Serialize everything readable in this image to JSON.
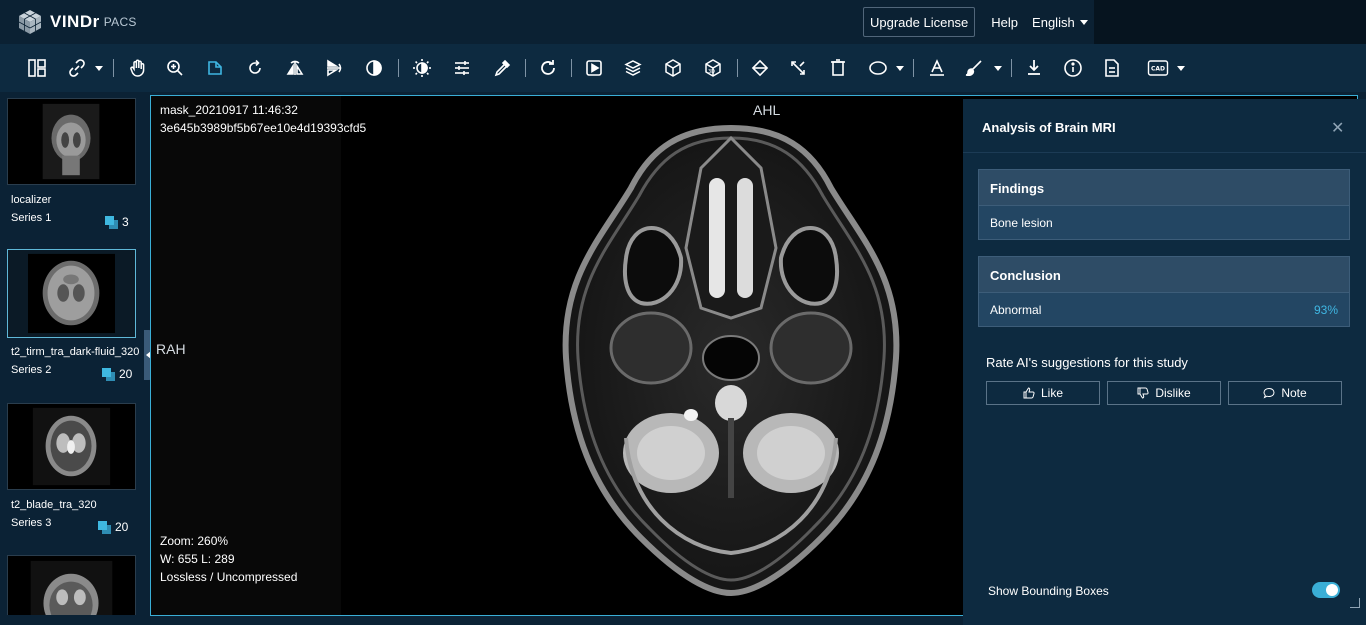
{
  "app": {
    "logo_text": "VINDr",
    "logo_sub": "PACS",
    "upgrade_label": "Upgrade License",
    "help_label": "Help",
    "language": "English"
  },
  "toolbar": {
    "tools": [
      "layout-icon",
      "link-icon",
      "pan-icon",
      "zoom-icon",
      "crop-icon",
      "rotate-icon",
      "flip-horizontal-icon",
      "flip-vertical-icon",
      "invert-icon",
      "window-level-icon",
      "adjust-icon",
      "eyedropper-icon",
      "reset-icon",
      "play-icon",
      "stack-icon",
      "mpr-icon",
      "3d-icon",
      "angle-icon",
      "expand-icon",
      "delete-icon",
      "ellipse-icon",
      "text-icon",
      "brush-icon",
      "download-icon",
      "info-icon",
      "report-icon",
      "cad-icon"
    ],
    "cad_label": "CAD"
  },
  "sidebar": {
    "series": [
      {
        "description": "localizer",
        "name": "Series 1",
        "count": "3"
      },
      {
        "description": "t2_tirm_tra_dark-fluid_320",
        "name": "Series 2",
        "count": "20"
      },
      {
        "description": "t2_blade_tra_320",
        "name": "Series 3",
        "count": "20"
      }
    ]
  },
  "viewport": {
    "top_left_1": "mask_20210917 11:46:32",
    "top_left_2": "3e645b3989bf5b67ee10e4d19393cfd5",
    "orient_top": "AHL",
    "orient_left": "RAH",
    "zoom": "Zoom: 260%",
    "window": "W: 655 L: 289",
    "compression": "Lossless / Uncompressed"
  },
  "panel": {
    "title": "Analysis of Brain MRI",
    "findings_title": "Findings",
    "finding_1": "Bone lesion",
    "conclusion_title": "Conclusion",
    "conclusion_value": "Abnormal",
    "conclusion_score": "93%",
    "rate_title": "Rate AI's suggestions for this study",
    "like_label": "Like",
    "dislike_label": "Dislike",
    "note_label": "Note",
    "bbox_label": "Show Bounding Boxes",
    "bbox_enabled": true
  },
  "colors": {
    "accent": "#3aaed6",
    "panel_bg": "#0d2a40",
    "header_bg": "#0b2133"
  }
}
